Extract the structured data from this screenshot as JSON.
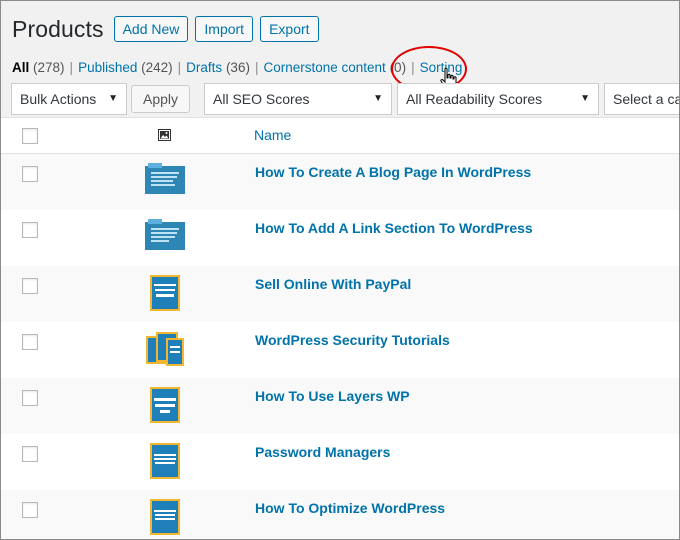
{
  "header": {
    "title": "Products",
    "buttons": {
      "add_new": "Add New",
      "import": "Import",
      "export": "Export"
    }
  },
  "filters": {
    "all": {
      "label": "All",
      "count": "(278)"
    },
    "published": {
      "label": "Published",
      "count": "(242)"
    },
    "drafts": {
      "label": "Drafts",
      "count": "(36)"
    },
    "cornerstone": {
      "label": "Cornerstone content",
      "count": "(0)"
    },
    "sorting": {
      "label": "Sorting"
    }
  },
  "tablenav": {
    "bulk_actions": "Bulk Actions",
    "apply": "Apply",
    "seo_scores": "All SEO Scores",
    "readability": "All Readability Scores",
    "category": "Select a cat"
  },
  "table": {
    "col_name": "Name",
    "rows": [
      {
        "title": "How To Create A Blog Page In WordPress",
        "thumb": "video-tutorial-thumb"
      },
      {
        "title": "How To Add A Link Section To WordPress",
        "thumb": "video-tutorial-thumb"
      },
      {
        "title": "Sell Online With PayPal",
        "thumb": "ebook-cover-thumb"
      },
      {
        "title": "WordPress Security Tutorials",
        "thumb": "ebook-bundle-thumb"
      },
      {
        "title": "How To Use Layers WP",
        "thumb": "ebook-cover-thumb"
      },
      {
        "title": "Password Managers",
        "thumb": "ebook-cover-thumb"
      },
      {
        "title": "How To Optimize WordPress",
        "thumb": "ebook-cover-thumb"
      }
    ]
  },
  "colors": {
    "link": "#0073aa",
    "highlight": "#e00000",
    "background": "#f1f1f1"
  }
}
